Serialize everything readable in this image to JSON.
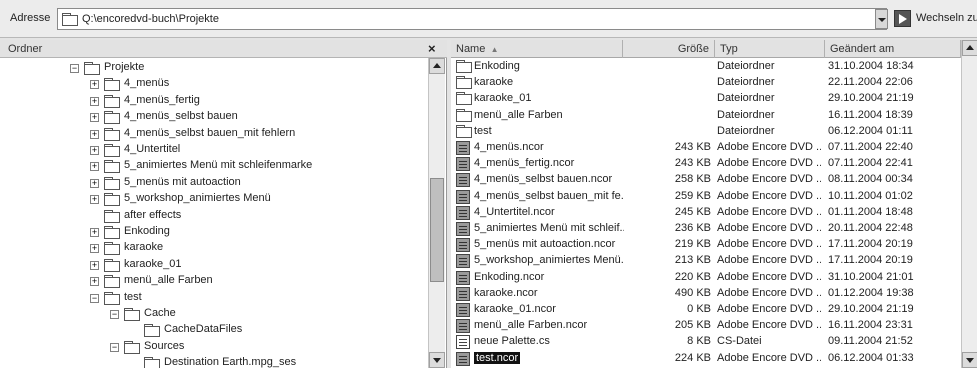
{
  "address": {
    "label": "Adresse",
    "path": "Q:\\encoredvd-buch\\Projekte",
    "go_label": "Wechseln zu"
  },
  "folders_pane": {
    "title": "Ordner",
    "close": "×"
  },
  "tree": [
    {
      "label": "Projekte",
      "expander": "minus",
      "level": 0
    },
    {
      "label": "4_menüs",
      "expander": "plus",
      "level": 1
    },
    {
      "label": "4_menüs_fertig",
      "expander": "plus",
      "level": 1
    },
    {
      "label": "4_menüs_selbst bauen",
      "expander": "plus",
      "level": 1
    },
    {
      "label": "4_menüs_selbst bauen_mit fehlern",
      "expander": "plus",
      "level": 1
    },
    {
      "label": "4_Untertitel",
      "expander": "plus",
      "level": 1
    },
    {
      "label": "5_animiertes Menü mit schleifenmarke",
      "expander": "plus",
      "level": 1
    },
    {
      "label": "5_menüs mit autoaction",
      "expander": "plus",
      "level": 1
    },
    {
      "label": "5_workshop_animiertes Menü",
      "expander": "plus",
      "level": 1
    },
    {
      "label": "after effects",
      "expander": "none",
      "level": 1
    },
    {
      "label": "Enkoding",
      "expander": "plus",
      "level": 1
    },
    {
      "label": "karaoke",
      "expander": "plus",
      "level": 1
    },
    {
      "label": "karaoke_01",
      "expander": "plus",
      "level": 1
    },
    {
      "label": "menü_alle Farben",
      "expander": "plus",
      "level": 1
    },
    {
      "label": "test",
      "expander": "minus",
      "level": 1
    },
    {
      "label": "Cache",
      "expander": "minus",
      "level": 2
    },
    {
      "label": "CacheDataFiles",
      "expander": "none",
      "level": 3
    },
    {
      "label": "Sources",
      "expander": "minus",
      "level": 2
    },
    {
      "label": "Destination Earth.mpg_ses",
      "expander": "none",
      "level": 3
    }
  ],
  "columns": {
    "name": "Name",
    "size": "Größe",
    "type": "Typ",
    "date": "Geändert am"
  },
  "files": [
    {
      "name": "Enkoding",
      "size": "",
      "type": "Dateiordner",
      "date": "31.10.2004 18:34",
      "icon": "folder"
    },
    {
      "name": "karaoke",
      "size": "",
      "type": "Dateiordner",
      "date": "22.11.2004 22:06",
      "icon": "folder"
    },
    {
      "name": "karaoke_01",
      "size": "",
      "type": "Dateiordner",
      "date": "29.10.2004 21:19",
      "icon": "folder"
    },
    {
      "name": "menü_alle Farben",
      "size": "",
      "type": "Dateiordner",
      "date": "16.11.2004 18:39",
      "icon": "folder"
    },
    {
      "name": "test",
      "size": "",
      "type": "Dateiordner",
      "date": "06.12.2004 01:11",
      "icon": "folder"
    },
    {
      "name": "4_menüs.ncor",
      "size": "243 KB",
      "type": "Adobe Encore DVD ...",
      "date": "07.11.2004 22:40",
      "icon": "ncor"
    },
    {
      "name": "4_menüs_fertig.ncor",
      "size": "243 KB",
      "type": "Adobe Encore DVD ...",
      "date": "07.11.2004 22:41",
      "icon": "ncor"
    },
    {
      "name": "4_menüs_selbst bauen.ncor",
      "size": "258 KB",
      "type": "Adobe Encore DVD ...",
      "date": "08.11.2004 00:34",
      "icon": "ncor"
    },
    {
      "name": "4_menüs_selbst bauen_mit fe...",
      "size": "259 KB",
      "type": "Adobe Encore DVD ...",
      "date": "10.11.2004 01:02",
      "icon": "ncor"
    },
    {
      "name": "4_Untertitel.ncor",
      "size": "245 KB",
      "type": "Adobe Encore DVD ...",
      "date": "01.11.2004 18:48",
      "icon": "ncor"
    },
    {
      "name": "5_animiertes Menü mit schleif...",
      "size": "236 KB",
      "type": "Adobe Encore DVD ...",
      "date": "20.11.2004 22:48",
      "icon": "ncor"
    },
    {
      "name": "5_menüs mit autoaction.ncor",
      "size": "219 KB",
      "type": "Adobe Encore DVD ...",
      "date": "17.11.2004 20:19",
      "icon": "ncor"
    },
    {
      "name": "5_workshop_animiertes Menü...",
      "size": "213 KB",
      "type": "Adobe Encore DVD ...",
      "date": "17.11.2004 20:19",
      "icon": "ncor"
    },
    {
      "name": "Enkoding.ncor",
      "size": "220 KB",
      "type": "Adobe Encore DVD ...",
      "date": "31.10.2004 21:01",
      "icon": "ncor"
    },
    {
      "name": "karaoke.ncor",
      "size": "490 KB",
      "type": "Adobe Encore DVD ...",
      "date": "01.12.2004 19:38",
      "icon": "ncor"
    },
    {
      "name": "karaoke_01.ncor",
      "size": "0 KB",
      "type": "Adobe Encore DVD ...",
      "date": "29.10.2004 21:19",
      "icon": "ncor"
    },
    {
      "name": "menü_alle Farben.ncor",
      "size": "205 KB",
      "type": "Adobe Encore DVD ...",
      "date": "16.11.2004 23:31",
      "icon": "ncor"
    },
    {
      "name": "neue Palette.cs",
      "size": "8 KB",
      "type": "CS-Datei",
      "date": "09.11.2004 21:52",
      "icon": "doc"
    },
    {
      "name": "test.ncor",
      "size": "224 KB",
      "type": "Adobe Encore DVD ...",
      "date": "06.12.2004 01:33",
      "icon": "ncor",
      "selected": true
    }
  ]
}
